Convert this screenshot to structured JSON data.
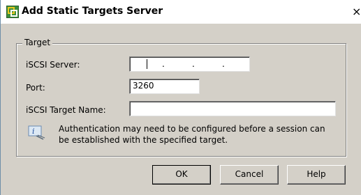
{
  "window": {
    "title": "Add Static Targets Server",
    "close_glyph": "×"
  },
  "target_group": {
    "legend": "Target",
    "iscsi_server": {
      "label": "iSCSI Server:",
      "value": "",
      "dots": [
        ".",
        ".",
        "."
      ]
    },
    "port": {
      "label": "Port:",
      "value": "3260"
    },
    "target_name": {
      "label": "iSCSI Target Name:",
      "value": ""
    },
    "info_message": "Authentication may need to be configured before a session can be established with the specified target."
  },
  "buttons": {
    "ok": "OK",
    "cancel": "Cancel",
    "help": "Help"
  },
  "icons": {
    "app": "vsphere-app-icon",
    "info": "info-icon",
    "close": "close-icon"
  },
  "colors": {
    "dialog_bg": "#d4d0c8",
    "app_icon": "#e8a020"
  }
}
